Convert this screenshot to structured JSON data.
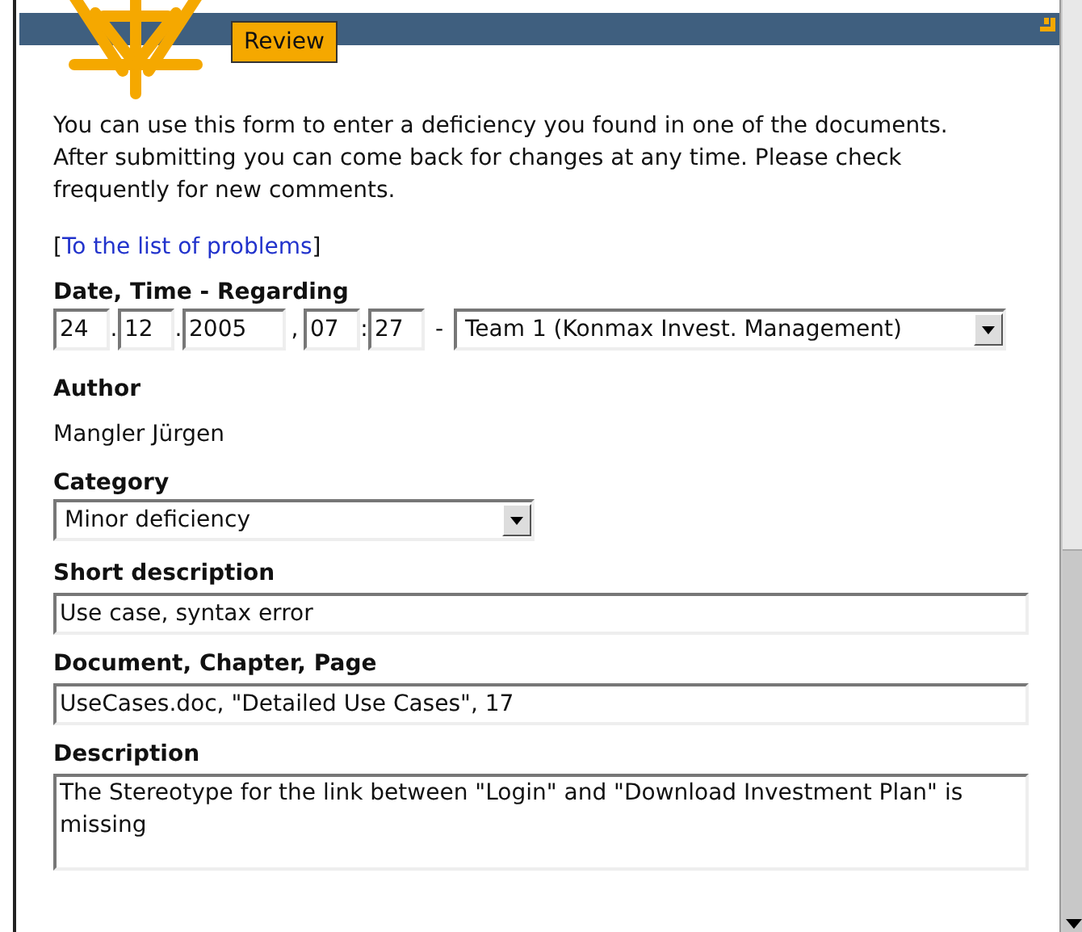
{
  "header": {
    "tab": "Review"
  },
  "intro": "You can use this form to enter a deficiency you found in one of the documents. After submitting you can come back for changes at any time. Please check frequently for new comments.",
  "link": {
    "open": "[",
    "label": "To the list of problems",
    "close": "]"
  },
  "date_time": {
    "label": "Date, Time - Regarding",
    "day": "24",
    "month": "12",
    "year": "2005",
    "hour": "07",
    "minute": "27",
    "sep_date_1": ".",
    "sep_date_2": ".",
    "sep_comma": ",",
    "sep_time": ":",
    "sep_dash": "-",
    "regarding": "Team 1 (Konmax Invest. Management)"
  },
  "author": {
    "label": "Author",
    "value": "Mangler Jürgen"
  },
  "category": {
    "label": "Category",
    "value": "Minor deficiency"
  },
  "short_description": {
    "label": "Short description",
    "value": "Use case, syntax error"
  },
  "document": {
    "label": "Document, Chapter, Page",
    "value": "UseCases.doc, \"Detailed Use Cases\", 17"
  },
  "description": {
    "label": "Description",
    "value": "The Stereotype for the link between \"Login\" and \"Download Investment Plan\" is missing"
  }
}
